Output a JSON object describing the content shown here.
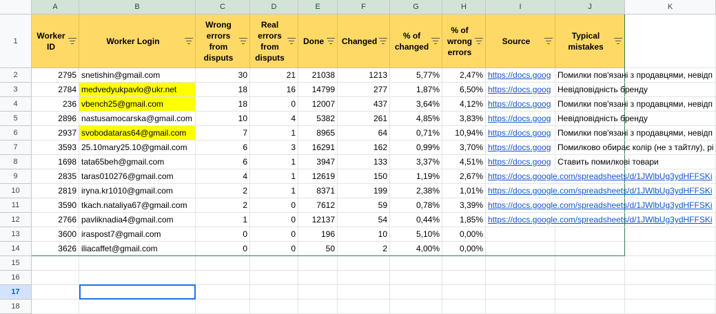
{
  "columns": [
    "A",
    "B",
    "C",
    "D",
    "E",
    "F",
    "G",
    "H",
    "I",
    "J",
    "K"
  ],
  "header": {
    "worker_id": "Worker\nID",
    "worker_login": "Worker Login",
    "wrong_errors": "Wrong\nerrors\nfrom\ndisputs",
    "real_errors": "Real\nerrors\nfrom\ndisputs",
    "done": "Done",
    "changed": "Changed",
    "pct_changed": "% of\nchanged",
    "pct_wrong": "% of\nwrong\nerrors",
    "source": "Source",
    "typical": "Typical\nmistakes"
  },
  "rows": [
    {
      "num": "2",
      "id": "2795",
      "login": "snetishin@gmail.com",
      "wrong": "30",
      "real": "21",
      "done": "21038",
      "changed": "1213",
      "pch": "5,77%",
      "pwr": "2,47%",
      "source": "https://docs.goog",
      "typical": "Помилки пов'язані з продавцями, невідп",
      "hl": false
    },
    {
      "num": "3",
      "id": "2784",
      "login": "medvedyukpavlo@ukr.net",
      "wrong": "18",
      "real": "16",
      "done": "14799",
      "changed": "277",
      "pch": "1,87%",
      "pwr": "6,50%",
      "source": "https://docs.goog",
      "typical": "Невідповідність бренду",
      "hl": true
    },
    {
      "num": "4",
      "id": "236",
      "login": "vbench25@gmail.com",
      "wrong": "18",
      "real": "0",
      "done": "12007",
      "changed": "437",
      "pch": "3,64%",
      "pwr": "4,12%",
      "source": "https://docs.goog",
      "typical": "Помилки пов'язані з продавцями, невідп",
      "hl": true
    },
    {
      "num": "5",
      "id": "2896",
      "login": "nastusamocarska@gmail.com",
      "wrong": "10",
      "real": "4",
      "done": "5382",
      "changed": "261",
      "pch": "4,85%",
      "pwr": "3,83%",
      "source": "https://docs.goog",
      "typical": "Невідповідність бренду",
      "hl": false
    },
    {
      "num": "6",
      "id": "2937",
      "login": "svobodataras64@gmail.com",
      "wrong": "7",
      "real": "1",
      "done": "8965",
      "changed": "64",
      "pch": "0,71%",
      "pwr": "10,94%",
      "source": "https://docs.goog",
      "typical": "Помилки пов'язані з продавцями, невідп",
      "hl": true
    },
    {
      "num": "7",
      "id": "3593",
      "login": "25.10mary25.10@gmail.com",
      "wrong": "6",
      "real": "3",
      "done": "16291",
      "changed": "162",
      "pch": "0,99%",
      "pwr": "3,70%",
      "source": "https://docs.goog",
      "typical": "Помилково обирає колір (не з тайтлу), рі",
      "hl": false
    },
    {
      "num": "8",
      "id": "1698",
      "login": "tata65beh@gmail.com",
      "wrong": "6",
      "real": "1",
      "done": "3947",
      "changed": "133",
      "pch": "3,37%",
      "pwr": "4,51%",
      "source": "https://docs.goog",
      "typical": "Ставить помилкові товари",
      "hl": false
    },
    {
      "num": "9",
      "id": "2835",
      "login": "taras010276@gmail.com",
      "wrong": "4",
      "real": "1",
      "done": "12619",
      "changed": "150",
      "pch": "1,19%",
      "pwr": "2,67%",
      "source": "https://docs.google.com/spreadsheets/d/1JWlbUg3ydHFFSKi",
      "typical": "",
      "hl": false
    },
    {
      "num": "10",
      "id": "2819",
      "login": "iryna.kr1010@gmail.com",
      "wrong": "2",
      "real": "1",
      "done": "8371",
      "changed": "199",
      "pch": "2,38%",
      "pwr": "1,01%",
      "source": "https://docs.google.com/spreadsheets/d/1JWlbUg3ydHFFSKi",
      "typical": "",
      "hl": false
    },
    {
      "num": "11",
      "id": "3590",
      "login": "tkach.nataliya67@gmail.com",
      "wrong": "2",
      "real": "0",
      "done": "7612",
      "changed": "59",
      "pch": "0,78%",
      "pwr": "3,39%",
      "source": "https://docs.google.com/spreadsheets/d/1JWlbUg3ydHFFSKi",
      "typical": "",
      "hl": false
    },
    {
      "num": "12",
      "id": "2766",
      "login": "pavliknadia4@gmail.com",
      "wrong": "1",
      "real": "0",
      "done": "12137",
      "changed": "54",
      "pch": "0,44%",
      "pwr": "1,85%",
      "source": "https://docs.google.com/spreadsheets/d/1JWlbUg3ydHFFSKi",
      "typical": "",
      "hl": false
    },
    {
      "num": "13",
      "id": "3600",
      "login": "iraspost7@gmail.com",
      "wrong": "0",
      "real": "0",
      "done": "196",
      "changed": "10",
      "pch": "5,10%",
      "pwr": "0,00%",
      "source": "",
      "typical": "",
      "hl": false
    },
    {
      "num": "14",
      "id": "3626",
      "login": "iliacaffet@gmail.com",
      "wrong": "0",
      "real": "0",
      "done": "50",
      "changed": "2",
      "pch": "4,00%",
      "pwr": "0,00%",
      "source": "",
      "typical": "",
      "hl": false
    }
  ],
  "empty_rows": [
    "15",
    "16",
    "17",
    "18"
  ],
  "header_row_num": "1",
  "active_row": "17",
  "colors": {
    "header_fill": "#ffd966",
    "highlight": "#ffff00",
    "link": "#1155cc",
    "selection": "#1a73e8"
  }
}
